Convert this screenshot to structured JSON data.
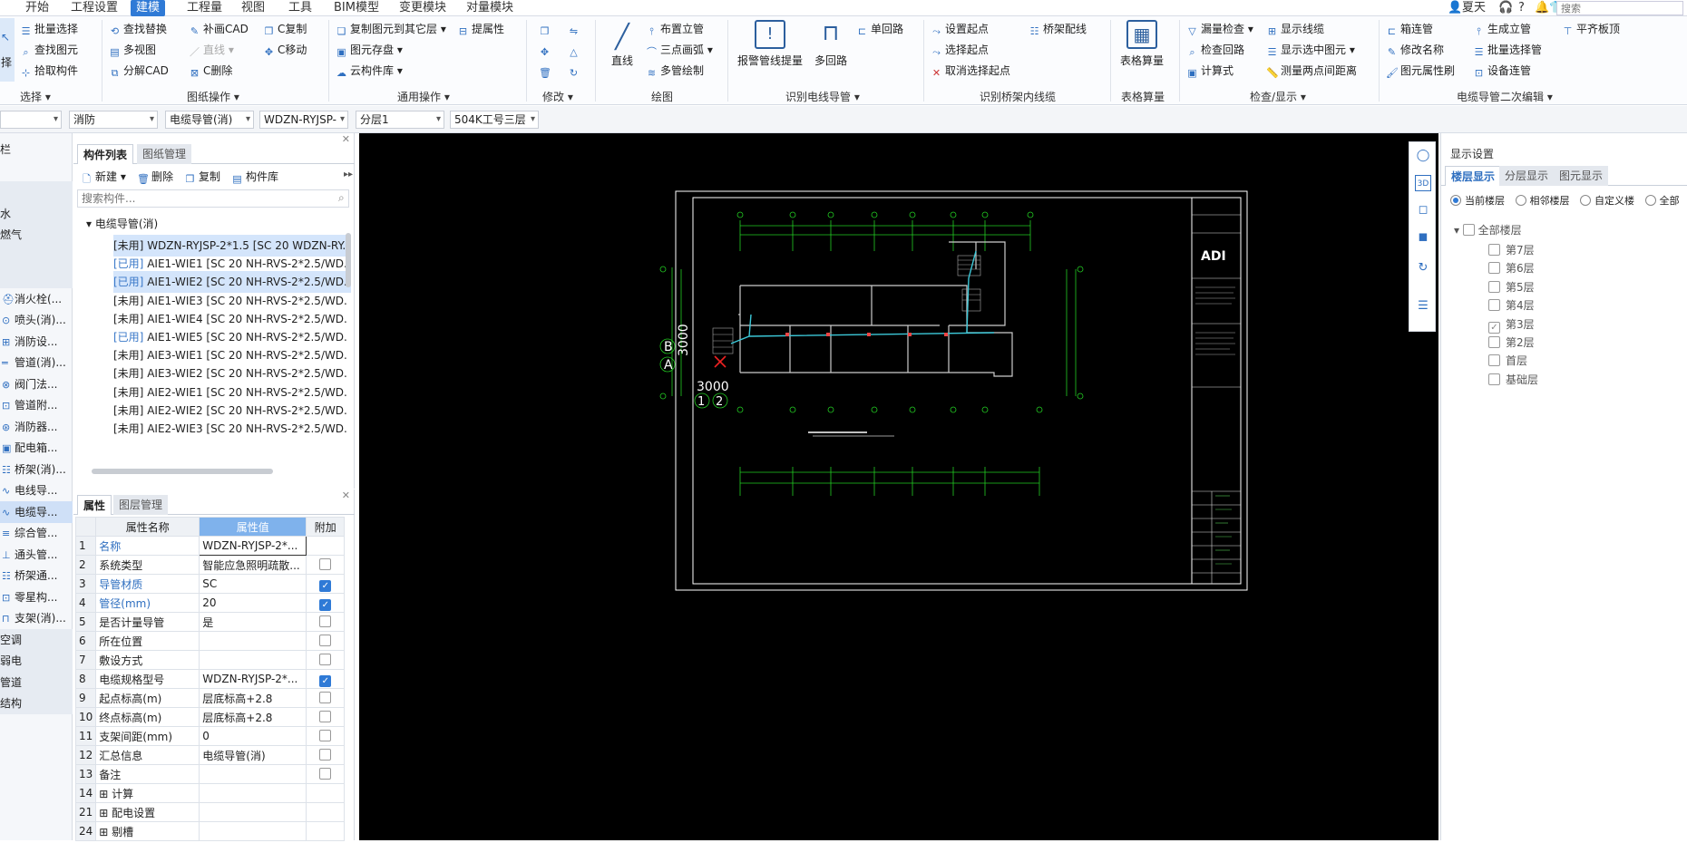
{
  "menubar": {
    "items": [
      "开始",
      "工程设置",
      "建模",
      "工程量",
      "视图",
      "工具",
      "BIM模型",
      "变更模块",
      "对量模块"
    ],
    "active": "建模",
    "user": "夏天",
    "help": "?",
    "search_placeholder": "搜索"
  },
  "ribbon": {
    "select": {
      "label": "选择",
      "big_label": "择",
      "items": [
        "批量选择",
        "查找图元",
        "拾取构件"
      ]
    },
    "drawing_ops": {
      "label": "图纸操作",
      "items": [
        "查找替换",
        "补画CAD",
        "C复制",
        "多视图",
        "直线",
        "C移动",
        "分解CAD",
        "C删除"
      ]
    },
    "common_ops": {
      "label": "通用操作",
      "items": [
        "复制图元到其它层",
        "提属性",
        "图元存盘",
        "云构件库"
      ]
    },
    "modify": {
      "label": "修改"
    },
    "draw": {
      "label": "绘图",
      "line": "直线",
      "items": [
        "布置立管",
        "三点画弧",
        "多管绘制"
      ]
    },
    "identify_cable": {
      "label": "识别电线导管",
      "items": [
        "报警管线提量",
        "多回路",
        "单回路"
      ]
    },
    "identify_tray": {
      "label": "识别桥架内线缆",
      "items": [
        "设置起点",
        "桥架配线",
        "选择起点",
        "取消选择起点"
      ]
    },
    "table": {
      "label": "表格算量",
      "big": "表格算量"
    },
    "check": {
      "label": "检查/显示",
      "items": [
        "漏量检查",
        "显示线缆",
        "检查回路",
        "显示选中图元",
        "计算式",
        "测量两点间距离"
      ]
    },
    "secondary": {
      "label": "电缆导管二次编辑",
      "items": [
        "箱连管",
        "生成立管",
        "平齐板顶",
        "修改名称",
        "批量选择管",
        "图元属性刷",
        "设备连管"
      ]
    }
  },
  "filterbar": {
    "values": [
      "",
      "消防",
      "电缆导管(消)",
      "WDZN-RYJSP-",
      "分层1",
      "504K工号三层"
    ]
  },
  "leftstrip": {
    "items": [
      {
        "text": "栏",
        "type": "plain"
      },
      {
        "text": "",
        "type": "plain"
      },
      {
        "text": "",
        "type": "cat"
      },
      {
        "text": "水",
        "type": "cat"
      },
      {
        "text": "燃气",
        "type": "cat"
      },
      {
        "text": "",
        "type": "cat"
      },
      {
        "text": "",
        "type": "cat"
      },
      {
        "text": "消火栓(...",
        "type": "plain"
      },
      {
        "text": "喷头(消)...",
        "type": "plain"
      },
      {
        "text": "消防设...",
        "type": "plain"
      },
      {
        "text": "管道(消)...",
        "type": "plain"
      },
      {
        "text": "阀门法...",
        "type": "plain"
      },
      {
        "text": "管道附...",
        "type": "plain"
      },
      {
        "text": "消防器...",
        "type": "plain"
      },
      {
        "text": "配电箱...",
        "type": "plain"
      },
      {
        "text": "桥架(消)...",
        "type": "plain"
      },
      {
        "text": "电线导...",
        "type": "plain"
      },
      {
        "text": "电缆导...",
        "type": "sel"
      },
      {
        "text": "综合管...",
        "type": "plain"
      },
      {
        "text": "通头管...",
        "type": "plain"
      },
      {
        "text": "桥架通...",
        "type": "plain"
      },
      {
        "text": "零星构...",
        "type": "plain"
      },
      {
        "text": "支架(消)...",
        "type": "plain"
      },
      {
        "text": "空调",
        "type": "cat"
      },
      {
        "text": "弱电",
        "type": "cat"
      },
      {
        "text": "管道",
        "type": "cat"
      },
      {
        "text": "结构",
        "type": "cat"
      }
    ]
  },
  "complist": {
    "tabs": [
      "构件列表",
      "图纸管理"
    ],
    "toolbar": [
      "新建",
      "删除",
      "复制",
      "构件库"
    ],
    "search_placeholder": "搜索构件...",
    "root": "电缆导管(消)",
    "rows": [
      {
        "status": "[未用]",
        "text": " WDZN-RYJSP-2*1.5 [SC 20 WDZN-RY.",
        "hl": true
      },
      {
        "status": "[已用]",
        "text": " AIE1-WIE1 [SC 20 NH-RVS-2*2.5/WD.",
        "hl": false
      },
      {
        "status": "[已用]",
        "text": " AIE1-WIE2 [SC 20 NH-RVS-2*2.5/WD.",
        "hl": true
      },
      {
        "status": "[未用]",
        "text": " AIE1-WIE3 [SC 20 NH-RVS-2*2.5/WD.",
        "hl": false
      },
      {
        "status": "[未用]",
        "text": " AIE1-WIE4 [SC 20 NH-RVS-2*2.5/WD.",
        "hl": false
      },
      {
        "status": "[已用]",
        "text": " AIE1-WIE5 [SC 20 NH-RVS-2*2.5/WD.",
        "hl": false
      },
      {
        "status": "[未用]",
        "text": " AIE3-WIE1 [SC 20 NH-RVS-2*2.5/WD.",
        "hl": false
      },
      {
        "status": "[未用]",
        "text": " AIE3-WIE2 [SC 20 NH-RVS-2*2.5/WD.",
        "hl": false
      },
      {
        "status": "[未用]",
        "text": " AIE2-WIE1 [SC 20 NH-RVS-2*2.5/WD.",
        "hl": false
      },
      {
        "status": "[未用]",
        "text": " AIE2-WIE2 [SC 20 NH-RVS-2*2.5/WD.",
        "hl": false
      },
      {
        "status": "[未用]",
        "text": " AIE2-WIE3 [SC 20 NH-RVS-2*2.5/WD.",
        "hl": false
      }
    ]
  },
  "props": {
    "tabs": [
      "属性",
      "图层管理"
    ],
    "headers": [
      "属性名称",
      "属性值",
      "附加"
    ],
    "rows": [
      {
        "n": "1",
        "name": "名称",
        "val": "WDZN-RYJSP-2*...",
        "chk": "none",
        "blue": true
      },
      {
        "n": "2",
        "name": "系统类型",
        "val": "智能应急照明疏散...",
        "chk": "off",
        "blue": false
      },
      {
        "n": "3",
        "name": "导管材质",
        "val": "SC",
        "chk": "on",
        "blue": true
      },
      {
        "n": "4",
        "name": "管径(mm)",
        "val": "20",
        "chk": "on",
        "blue": true
      },
      {
        "n": "5",
        "name": "是否计量导管",
        "val": "是",
        "chk": "off",
        "blue": false
      },
      {
        "n": "6",
        "name": "所在位置",
        "val": "",
        "chk": "off",
        "blue": false
      },
      {
        "n": "7",
        "name": "敷设方式",
        "val": "",
        "chk": "off",
        "blue": false
      },
      {
        "n": "8",
        "name": "电缆规格型号",
        "val": "WDZN-RYJSP-2*...",
        "chk": "on",
        "blue": false
      },
      {
        "n": "9",
        "name": "起点标高(m)",
        "val": "层底标高+2.8",
        "chk": "off",
        "blue": false
      },
      {
        "n": "10",
        "name": "终点标高(m)",
        "val": "层底标高+2.8",
        "chk": "off",
        "blue": false
      },
      {
        "n": "11",
        "name": "支架间距(mm)",
        "val": "0",
        "chk": "off",
        "blue": false
      },
      {
        "n": "12",
        "name": "汇总信息",
        "val": "电缆导管(消)",
        "chk": "off",
        "blue": false
      },
      {
        "n": "13",
        "name": "备注",
        "val": "",
        "chk": "off",
        "blue": false
      },
      {
        "n": "14",
        "name": "⊞ 计算",
        "val": "",
        "chk": "none",
        "blue": false
      },
      {
        "n": "21",
        "name": "⊞ 配电设置",
        "val": "",
        "chk": "none",
        "blue": false
      },
      {
        "n": "24",
        "name": "⊞ 剔槽",
        "val": "",
        "chk": "none",
        "blue": false
      }
    ]
  },
  "canvas": {
    "labels": {
      "b": "B",
      "a": "A",
      "dim_v": "3000",
      "dim_h": "3000",
      "n1": "1",
      "n2": "2",
      "logo": "ADI"
    }
  },
  "rightpanel": {
    "title": "显示设置",
    "tabs": [
      "楼层显示",
      "分层显示",
      "图元显示"
    ],
    "radios": [
      "当前楼层",
      "相邻楼层",
      "自定义楼",
      "全部"
    ],
    "all_floors": "全部楼层",
    "floors": [
      {
        "name": "第7层",
        "checked": false
      },
      {
        "name": "第6层",
        "checked": false
      },
      {
        "name": "第5层",
        "checked": false
      },
      {
        "name": "第4层",
        "checked": false
      },
      {
        "name": "第3层",
        "checked": true
      },
      {
        "name": "第2层",
        "checked": false
      },
      {
        "name": "首层",
        "checked": false
      },
      {
        "name": "基础层",
        "checked": false
      }
    ]
  }
}
